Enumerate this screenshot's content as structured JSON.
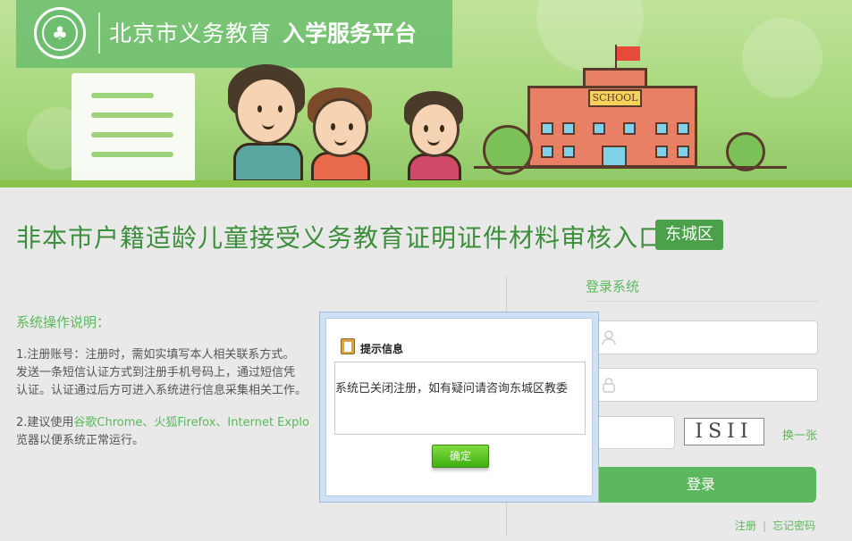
{
  "header": {
    "city_label": "北京市义务教育",
    "platform_label": "入学服务平台",
    "school_sign": "SCHOOL"
  },
  "page": {
    "title": "非本市户籍适龄儿童接受义务教育证明证件材料审核入口",
    "district": "东城区"
  },
  "instructions": {
    "title": "系统操作说明：",
    "item1": [
      "1.注册账号：注册时，需如实填写本人相关联系方式。",
      "发送一条短信认证方式到注册手机号码上，通过短信凭",
      "认证。认证通过后方可进入系统进行信息采集相关工作。"
    ],
    "item2_prefix": "2.建议使用",
    "item2_browsers": "谷歌Chrome、火狐Firefox、Internet Explo",
    "item2_line2": "览器以便系统正常运行。"
  },
  "login": {
    "title": "登录系统",
    "captcha_text": "ISII",
    "refresh_label": "换一张",
    "login_button": "登录",
    "register_link": "注册",
    "separator": "|",
    "forgot_link": "忘记密码"
  },
  "dialog": {
    "title": "提示信息",
    "message": "系统已关闭注册，如有疑问请咨询东城区教委",
    "ok_button": "确定"
  },
  "colors": {
    "brand_green": "#5cb85c",
    "title_green": "#3d8f3d",
    "badge_green": "#4aa14a"
  }
}
